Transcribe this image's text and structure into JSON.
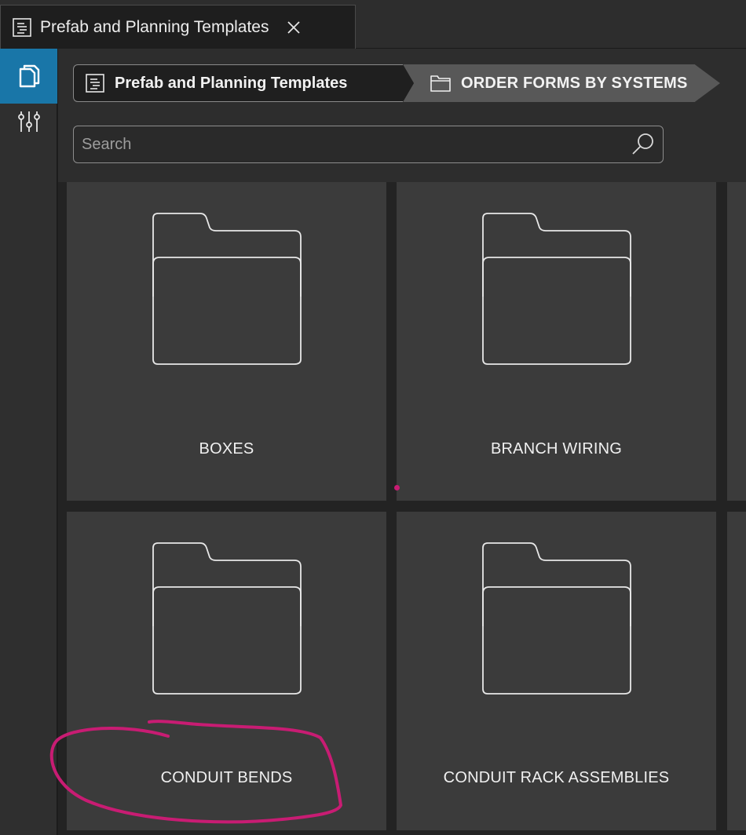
{
  "tab": {
    "title": "Prefab and Planning Templates",
    "icon": "template-doc-icon",
    "close_icon": "close-icon"
  },
  "rail": {
    "items": [
      {
        "icon": "copy-pages-icon",
        "active": true
      },
      {
        "icon": "sliders-icon",
        "active": false
      }
    ],
    "active_color": "#1976a8"
  },
  "breadcrumb": {
    "items": [
      {
        "label": "Prefab and Planning Templates",
        "icon": "template-doc-icon"
      },
      {
        "label": "ORDER FORMS BY SYSTEMS",
        "icon": "folder-icon"
      }
    ]
  },
  "search": {
    "placeholder": "Search",
    "value": "",
    "icon": "search-icon"
  },
  "grid": {
    "items": [
      {
        "label": "BOXES",
        "icon": "folder-icon"
      },
      {
        "label": "BRANCH WIRING",
        "icon": "folder-icon"
      },
      {
        "label": "CONDUIT BENDS",
        "icon": "folder-icon"
      },
      {
        "label": "CONDUIT RACK ASSEMBLIES",
        "icon": "folder-icon"
      }
    ]
  },
  "annotation": {
    "target": "CONDUIT BENDS",
    "color": "#c81c73"
  }
}
